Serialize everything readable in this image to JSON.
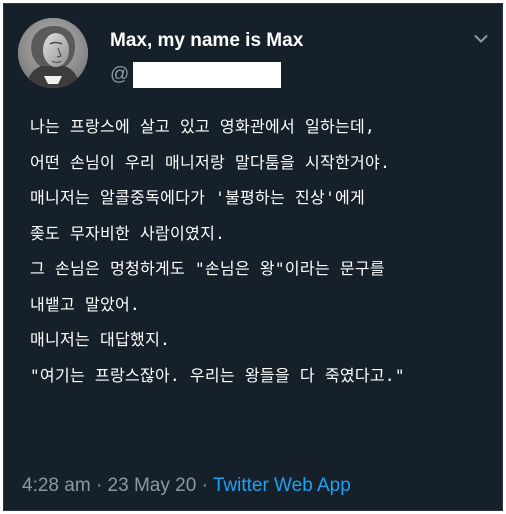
{
  "tweet": {
    "author": {
      "display_name": "Max, my name is Max",
      "handle_prefix": "@"
    },
    "menu_icon": "chevron-down-icon",
    "lines": [
      "나는 프랑스에 살고 있고 영화관에서 일하는데,",
      "어떤 손님이 우리 매니저랑 말다툼을 시작한거야.",
      "매니저는 알콜중독에다가 '불평하는 진상'에게",
      "좆도 무자비한 사람이였지.",
      "그 손님은 멍청하게도 \"손님은 왕\"이라는 문구를",
      "내뱉고 말았어.",
      "매니저는 대답했지.",
      "\"여기는 프랑스잖아. 우리는 왕들을 다 죽였다고.\""
    ],
    "time": "4:28 am",
    "separator": "·",
    "date": "23 May 20",
    "source": "Twitter Web App"
  },
  "colors": {
    "background": "#16202b",
    "text": "#ffffff",
    "muted": "#8899a6",
    "link": "#1da1f2"
  }
}
